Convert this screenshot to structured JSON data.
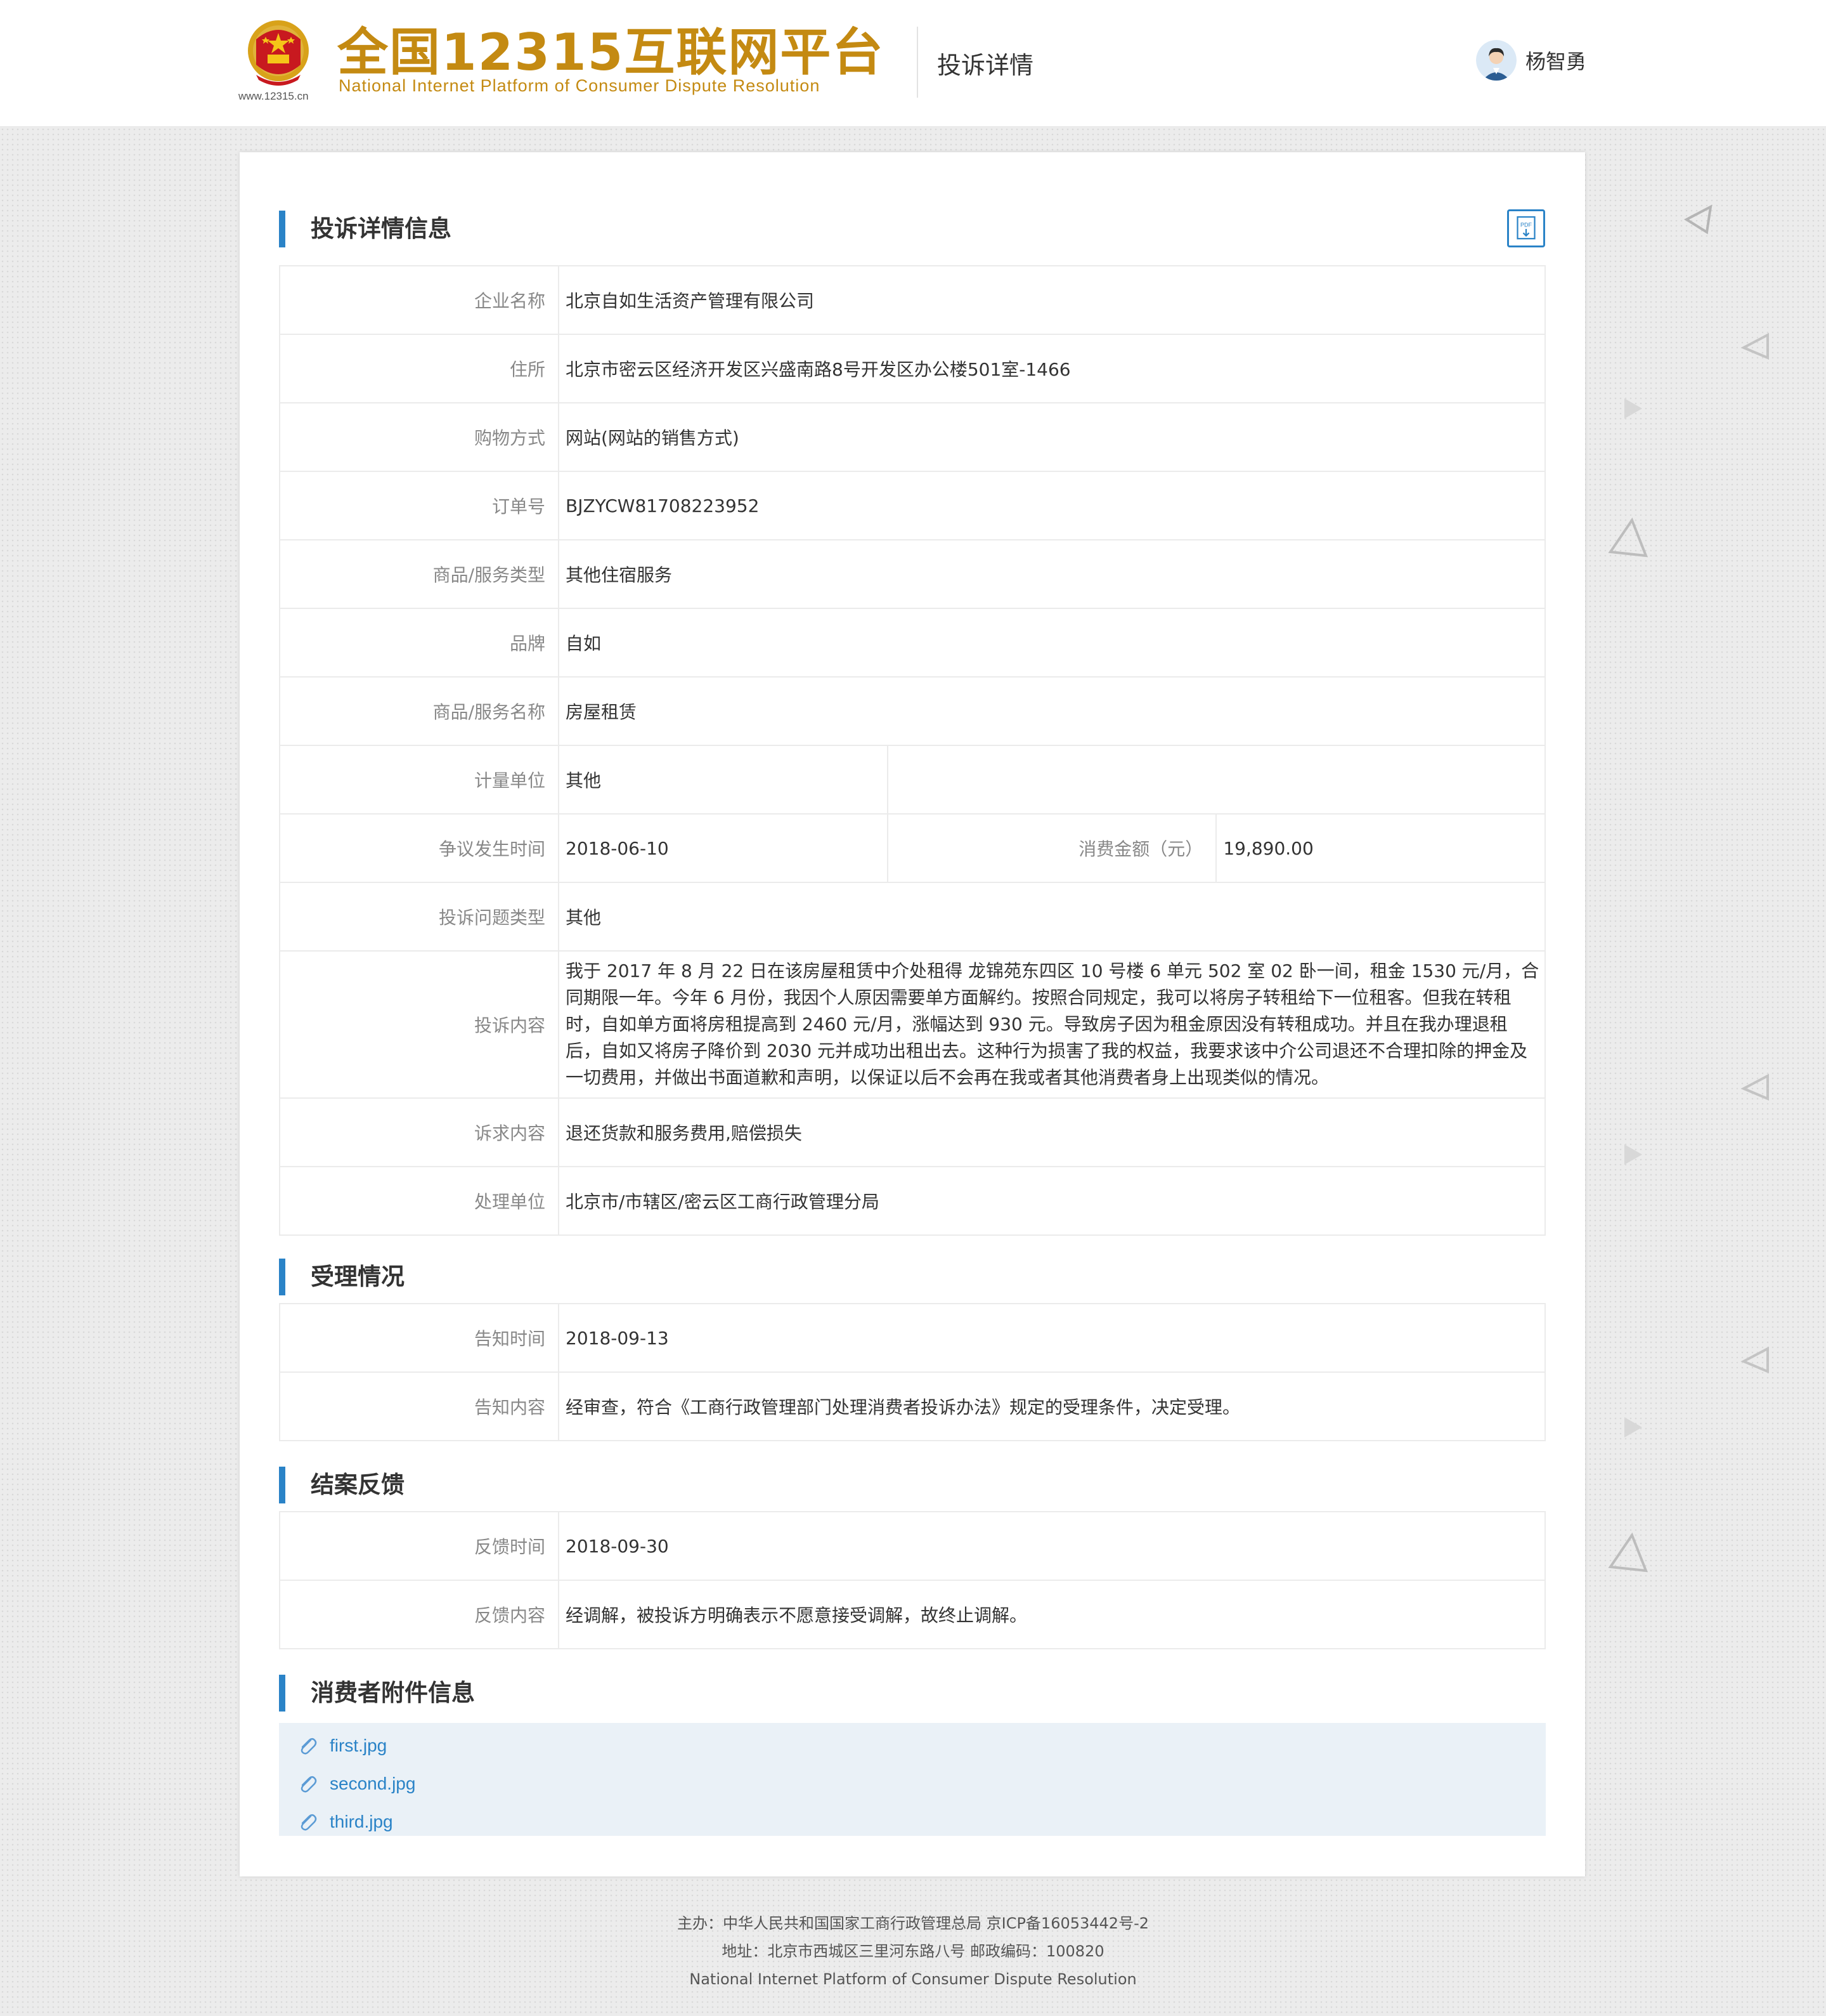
{
  "header": {
    "logo_cn": "全国12315互联网平台",
    "logo_en": "National Internet Platform of Consumer Dispute Resolution",
    "logo_url": "www.12315.cn",
    "page_title": "投诉详情",
    "user_name": "杨智勇"
  },
  "sections": {
    "detail_title": "投诉详情信息",
    "acceptance_title": "受理情况",
    "feedback_title": "结案反馈",
    "attachments_title": "消费者附件信息"
  },
  "detail": {
    "company_label": "企业名称",
    "company": "北京自如生活资产管理有限公司",
    "address_label": "住所",
    "address": "北京市密云区经济开发区兴盛南路8号开发区办公楼501室-1466",
    "shopping_label": "购物方式",
    "shopping": "网站(网站的销售方式)",
    "order_label": "订单号",
    "order": "BJZYCW81708223952",
    "goods_type_label": "商品/服务类型",
    "goods_type": "其他住宿服务",
    "brand_label": "品牌",
    "brand": "自如",
    "goods_name_label": "商品/服务名称",
    "goods_name": "房屋租赁",
    "unit_label": "计量单位",
    "unit": "其他",
    "dispute_time_label": "争议发生时间",
    "dispute_time": "2018-06-10",
    "amount_label": "消费金额（元）",
    "amount": "19,890.00",
    "problem_type_label": "投诉问题类型",
    "problem_type": "其他",
    "content_label": "投诉内容",
    "content": "我于 2017 年 8 月 22 日在该房屋租赁中介处租得 龙锦苑东四区 10 号楼 6 单元 502 室 02 卧一间，租金 1530 元/月，合同期限一年。今年 6 月份，我因个人原因需要单方面解约。按照合同规定，我可以将房子转租给下一位租客。但我在转租时，自如单方面将房租提高到 2460 元/月，涨幅达到 930 元。导致房子因为租金原因没有转租成功。并且在我办理退租后，自如又将房子降价到 2030 元并成功出租出去。这种行为损害了我的权益，我要求该中介公司退还不合理扣除的押金及一切费用，并做出书面道歉和声明，以保证以后不会再在我或者其他消费者身上出现类似的情况。",
    "appeal_label": "诉求内容",
    "appeal": "退还货款和服务费用,赔偿损失",
    "handler_label": "处理单位",
    "handler": "北京市/市辖区/密云区工商行政管理分局"
  },
  "acceptance": {
    "time_label": "告知时间",
    "time": "2018-09-13",
    "content_label": "告知内容",
    "content": "经审查，符合《工商行政管理部门处理消费者投诉办法》规定的受理条件，决定受理。"
  },
  "feedback": {
    "time_label": "反馈时间",
    "time": "2018-09-30",
    "content_label": "反馈内容",
    "content": "经调解，被投诉方明确表示不愿意接受调解，故终止调解。"
  },
  "attachments": [
    {
      "name": "first.jpg",
      "icon": "paperclip-icon"
    },
    {
      "name": "second.jpg",
      "icon": "paperclip-icon"
    },
    {
      "name": "third.jpg",
      "icon": "paperclip-icon"
    }
  ],
  "footer": {
    "line1": "主办：中华人民共和国国家工商行政管理总局 京ICP备16053442号-2",
    "line2": "地址：北京市西城区三里河东路八号 邮政编码：100820",
    "line3": "National Internet Platform of Consumer Dispute Resolution"
  },
  "colors": {
    "accent": "#2a83c7",
    "logo_gold": "#c48a12",
    "attachment_bg": "#eaf1f7"
  }
}
